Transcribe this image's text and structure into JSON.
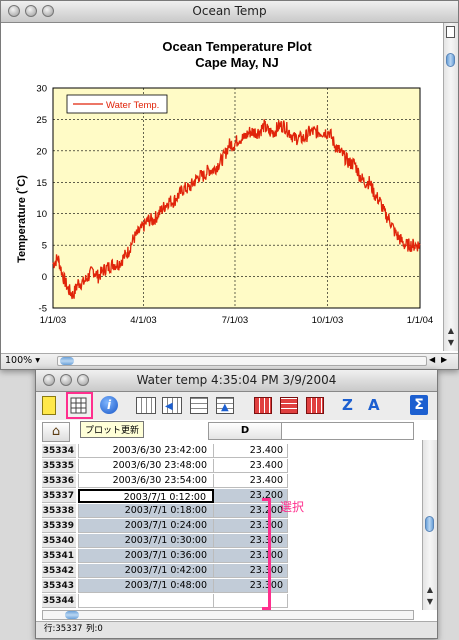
{
  "chart_window": {
    "title": "Ocean Temp",
    "zoom": "100%"
  },
  "chart_data": {
    "type": "line",
    "title": "Ocean Temperature Plot",
    "subtitle": "Cape May, NJ",
    "ylabel": "Temperature (˚C)",
    "xlabel": "",
    "ylim": [
      -5,
      30
    ],
    "yticks": [
      "-5",
      "0",
      "5",
      "10",
      "15",
      "20",
      "25",
      "30"
    ],
    "xticks": [
      "1/1/03",
      "4/1/03",
      "7/1/03",
      "10/1/03",
      "1/1/04"
    ],
    "legend": "top-left",
    "grid": true,
    "series": [
      {
        "name": "Water Temp.",
        "color": "#e0240a",
        "x_days": [
          0,
          5,
          10,
          15,
          20,
          25,
          30,
          35,
          40,
          45,
          50,
          55,
          60,
          65,
          70,
          75,
          80,
          85,
          90,
          95,
          100,
          105,
          110,
          115,
          120,
          125,
          130,
          135,
          140,
          145,
          150,
          155,
          160,
          165,
          170,
          175,
          180,
          185,
          190,
          195,
          200,
          205,
          210,
          215,
          220,
          225,
          230,
          235,
          240,
          245,
          250,
          255,
          260,
          265,
          270,
          275,
          280,
          285,
          290,
          295,
          300,
          305,
          310,
          315,
          320,
          325,
          330,
          335,
          340,
          345,
          350,
          355,
          360,
          365
        ],
        "y": [
          2,
          3,
          0,
          -2,
          -3,
          -1,
          -1,
          0,
          1,
          0,
          1,
          1.5,
          2,
          2,
          3,
          4,
          6,
          7,
          8,
          9,
          9,
          10,
          11,
          12,
          12,
          13,
          14,
          14,
          15,
          16,
          16,
          17,
          17,
          18,
          19,
          21,
          21,
          22,
          22,
          23,
          23,
          23,
          24,
          23,
          23,
          24,
          24,
          23,
          22,
          22,
          22,
          23,
          23,
          23,
          23,
          23,
          21,
          20,
          19,
          18,
          18,
          16,
          15,
          15,
          13,
          12,
          10,
          9,
          7,
          6,
          5,
          5,
          5,
          5
        ]
      }
    ]
  },
  "table_window": {
    "title": "Water temp 4:35:04 PM 3/9/2004",
    "tooltip": "プロット更新",
    "column_header": "D",
    "annotation": "選択",
    "status_row_label": "行:35337",
    "status_col_label": "列:0",
    "rows": [
      {
        "n": "35334",
        "t": "2003/6/30 23:42:00",
        "v": "23.400"
      },
      {
        "n": "35335",
        "t": "2003/6/30 23:48:00",
        "v": "23.400"
      },
      {
        "n": "35336",
        "t": "2003/6/30 23:54:00",
        "v": "23.400"
      },
      {
        "n": "35337",
        "t": "2003/7/1 0:12:00",
        "v": "23.200"
      },
      {
        "n": "35338",
        "t": "2003/7/1 0:18:00",
        "v": "23.200"
      },
      {
        "n": "35339",
        "t": "2003/7/1 0:24:00",
        "v": "23.300"
      },
      {
        "n": "35340",
        "t": "2003/7/1 0:30:00",
        "v": "23.300"
      },
      {
        "n": "35341",
        "t": "2003/7/1 0:36:00",
        "v": "23.100"
      },
      {
        "n": "35342",
        "t": "2003/7/1 0:42:00",
        "v": "23.300"
      },
      {
        "n": "35343",
        "t": "2003/7/1 0:48:00",
        "v": "23.300"
      },
      {
        "n": "35344",
        "t": "",
        "v": ""
      }
    ]
  }
}
